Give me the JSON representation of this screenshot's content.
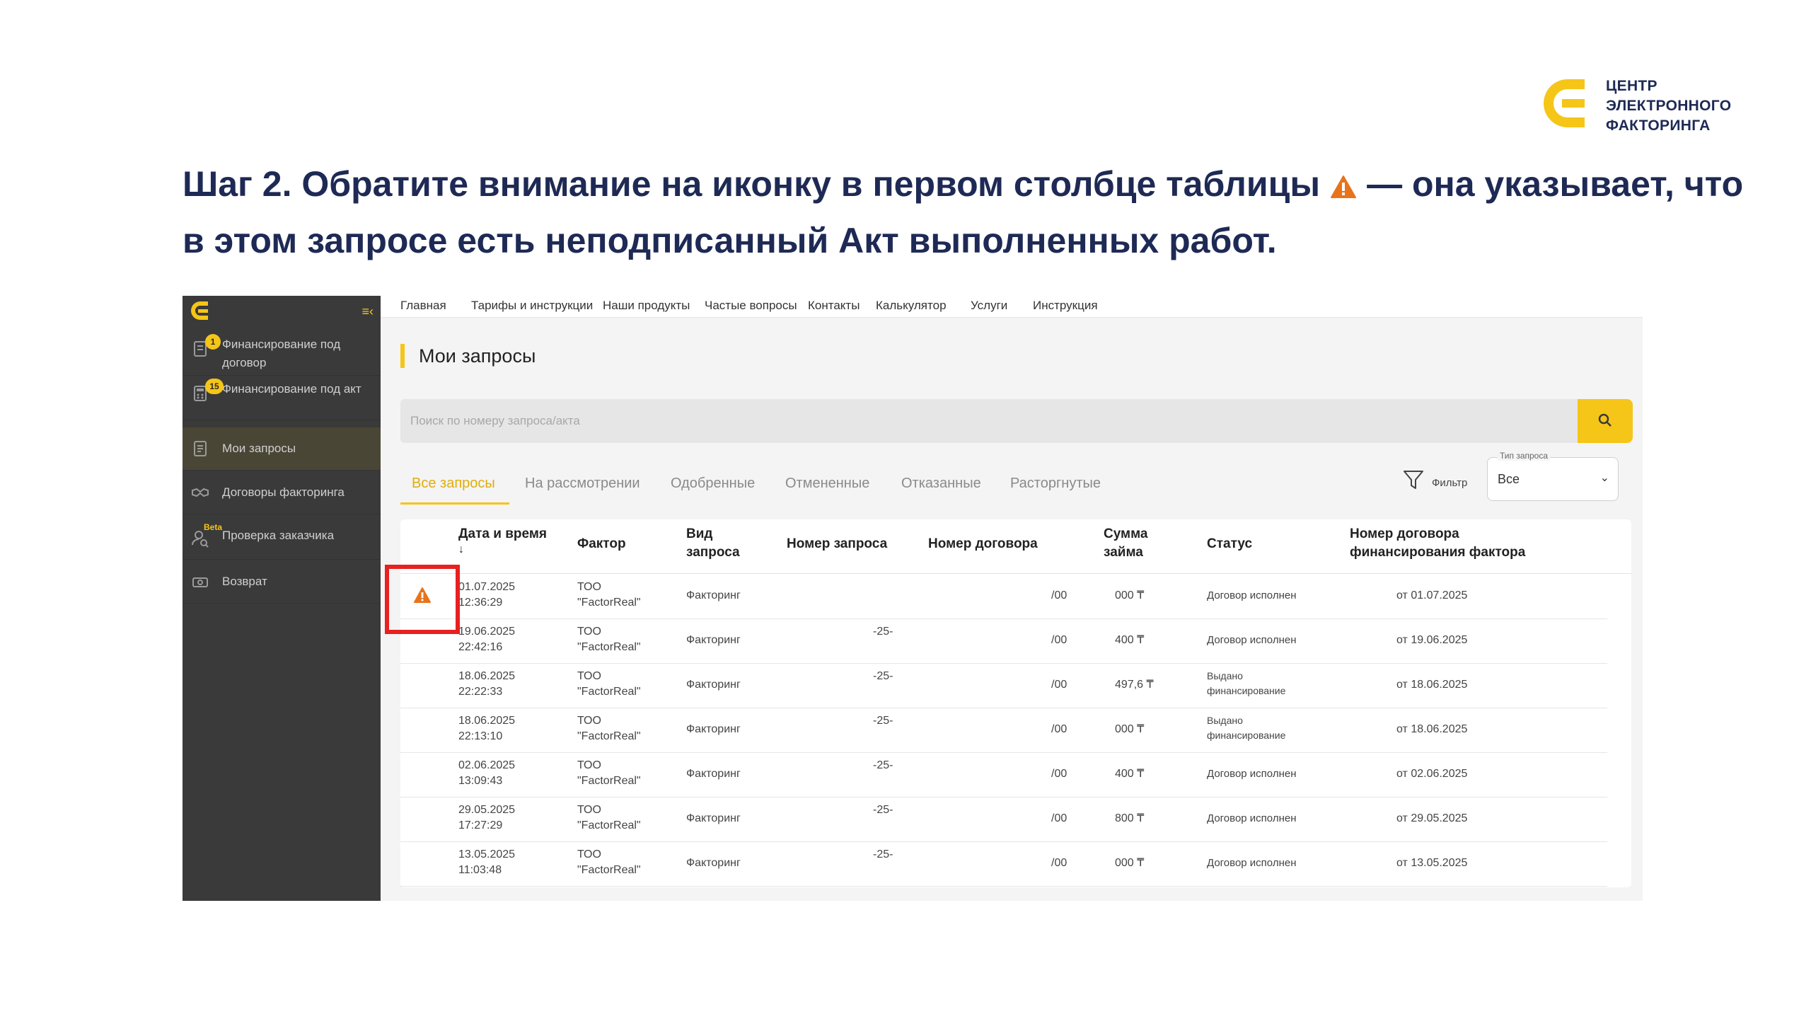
{
  "brand": {
    "lines": [
      "ЦЕНТР",
      "ЭЛЕКТРОННОГО",
      "ФАКТОРИНГА"
    ],
    "accent": "#f5c518"
  },
  "slide": {
    "title_part1": "Шаг 2.  Обратите внимание на иконку в первом столбце таблицы",
    "title_part2": "— она указывает, что в этом запросе есть неподписанный Акт выполненных работ.",
    "title_color": "#1e2a55"
  },
  "sidebar": {
    "items": [
      {
        "label": "Финансирование под договор",
        "badge": "1",
        "icon": "document-money-icon"
      },
      {
        "label": "Финансирование под акт",
        "badge": "15",
        "icon": "calculator-icon"
      },
      {
        "label": "Мои запросы",
        "icon": "requests-icon",
        "active": true
      },
      {
        "label": "Договоры факторинга",
        "icon": "handshake-icon"
      },
      {
        "label": "Проверка заказчика",
        "beta": "Beta",
        "icon": "user-search-icon"
      },
      {
        "label": "Возврат",
        "icon": "money-return-icon"
      }
    ]
  },
  "topnav": [
    "Главная",
    "Тарифы и инструкции",
    "Наши продукты",
    "Частые вопросы",
    "Контакты",
    "Калькулятор",
    "Услуги",
    "Инструкция"
  ],
  "page": {
    "title": "Мои запросы",
    "search_placeholder": "Поиск по номеру запроса/акта"
  },
  "tabs": [
    "Все запросы",
    "На рассмотрении",
    "Одобренные",
    "Отмененные",
    "Отказанные",
    "Расторгнутые"
  ],
  "filter": {
    "label": "Фильтр",
    "type_label": "Тип запроса",
    "type_value": "Все"
  },
  "table": {
    "headers": {
      "date": "Дата и время",
      "sort": "↓",
      "factor": "Фактор",
      "type_l1": "Вид",
      "type_l2": "запроса",
      "req": "Номер запроса",
      "contract": "Номер договора",
      "sum_l1": "Сумма",
      "sum_l2": "займа",
      "status": "Статус",
      "fin_l1": "Номер договора",
      "fin_l2": "финансирования фактора"
    },
    "rows": [
      {
        "date": "01.07.2025",
        "time": "12:36:29",
        "f1": "ТОО",
        "f2": "\"FactorReal\"",
        "type": "Факторинг",
        "req": "",
        "contract": "/00",
        "sum": "000 ₸",
        "status1": "Договор исполнен",
        "status2": "",
        "fin": "от 01.07.2025",
        "warn": true
      },
      {
        "date": "19.06.2025",
        "time": "22:42:16",
        "f1": "ТОО",
        "f2": "\"FactorReal\"",
        "type": "Факторинг",
        "req": "-25-",
        "contract": "/00",
        "sum": "400 ₸",
        "status1": "Договор исполнен",
        "status2": "",
        "fin": "от 19.06.2025",
        "warn": false
      },
      {
        "date": "18.06.2025",
        "time": "22:22:33",
        "f1": "ТОО",
        "f2": "\"FactorReal\"",
        "type": "Факторинг",
        "req": "-25-",
        "contract": "/00",
        "sum": "497,6 ₸",
        "status1": "Выдано",
        "status2": "финансирование",
        "fin": "от 18.06.2025",
        "warn": false
      },
      {
        "date": "18.06.2025",
        "time": "22:13:10",
        "f1": "ТОО",
        "f2": "\"FactorReal\"",
        "type": "Факторинг",
        "req": "-25-",
        "contract": "/00",
        "sum": "000 ₸",
        "status1": "Выдано",
        "status2": "финансирование",
        "fin": "от 18.06.2025",
        "warn": false
      },
      {
        "date": "02.06.2025",
        "time": "13:09:43",
        "f1": "ТОО",
        "f2": "\"FactorReal\"",
        "type": "Факторинг",
        "req": "-25-",
        "contract": "/00",
        "sum": "400 ₸",
        "status1": "Договор исполнен",
        "status2": "",
        "fin": "от 02.06.2025",
        "warn": false
      },
      {
        "date": "29.05.2025",
        "time": "17:27:29",
        "f1": "ТОО",
        "f2": "\"FactorReal\"",
        "type": "Факторинг",
        "req": "-25-",
        "contract": "/00",
        "sum": "800 ₸",
        "status1": "Договор исполнен",
        "status2": "",
        "fin": "от 29.05.2025",
        "warn": false
      },
      {
        "date": "13.05.2025",
        "time": "11:03:48",
        "f1": "ТОО",
        "f2": "\"FactorReal\"",
        "type": "Факторинг",
        "req": "-25-",
        "contract": "/00",
        "sum": "000 ₸",
        "status1": "Договор исполнен",
        "status2": "",
        "fin": "от 13.05.2025",
        "warn": false
      }
    ]
  },
  "colors": {
    "warning": "#e8731a",
    "highlight": "#e82020",
    "sidebar_bg": "#3a3a3a"
  }
}
